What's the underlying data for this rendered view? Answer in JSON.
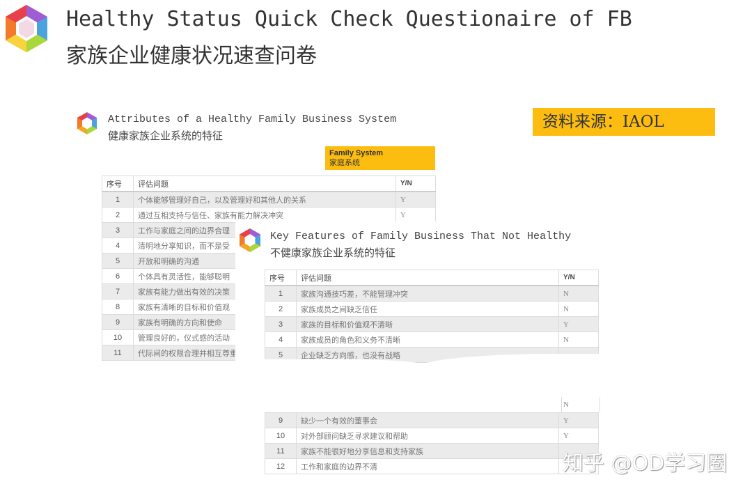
{
  "header": {
    "logo_icon": "hexagon-logo-icon",
    "title_en": "Healthy Status Quick Check Questionaire of FB",
    "title_zh": "家族企业健康状况速查问卷"
  },
  "source": {
    "label": "资料来源：IAOL"
  },
  "healthy_section": {
    "icon": "hexagon-logo-icon",
    "title_en": "Attributes of a Healthy Family Business System",
    "title_zh": "健康家族企业系统的特征",
    "tag_en": "Family System",
    "tag_zh": "家庭系统",
    "columns": [
      "序号",
      "评估问题",
      "Y/N"
    ],
    "rows": [
      {
        "num": "1",
        "question": "个体能够管理好自己，以及管理好和其他人的关系",
        "yn": "Y"
      },
      {
        "num": "2",
        "question": "通过互相支持与信任、家族有能力解决冲突",
        "yn": "Y"
      },
      {
        "num": "3",
        "question": "工作与家庭之间的边界合理",
        "yn": ""
      },
      {
        "num": "4",
        "question": "清明地分享知识，而不是受",
        "yn": ""
      },
      {
        "num": "5",
        "question": "开放和明确的沟通",
        "yn": ""
      },
      {
        "num": "6",
        "question": "个体具有灵活性，能够聪明",
        "yn": ""
      },
      {
        "num": "7",
        "question": "家族有能力做出有效的决策",
        "yn": ""
      },
      {
        "num": "8",
        "question": "家族有清晰的目标和价值观",
        "yn": ""
      },
      {
        "num": "9",
        "question": "家族有明确的方向和使命",
        "yn": ""
      },
      {
        "num": "10",
        "question": "管理良好的，仪式感的活动",
        "yn": ""
      },
      {
        "num": "11",
        "question": "代际间的权限合理并相互尊重",
        "yn": ""
      }
    ]
  },
  "unhealthy_section": {
    "icon": "hexagon-logo-icon",
    "title_en": "Key Features of Family Business That Not Healthy",
    "title_zh": "不健康家族企业系统的特征",
    "columns": [
      "序号",
      "评估问题",
      "Y/N"
    ],
    "rows_top": [
      {
        "num": "1",
        "question": "家族沟通技巧差，不能管理冲突",
        "yn": "N"
      },
      {
        "num": "2",
        "question": "家族成员之间缺乏信任",
        "yn": "N"
      },
      {
        "num": "3",
        "question": "家族的目标和价值观不清晰",
        "yn": "Y"
      },
      {
        "num": "4",
        "question": "家族成员的角色和义务不清晰",
        "yn": "N"
      },
      {
        "num": "5",
        "question": "企业缺乏方向感，也没有战略",
        "yn": ""
      }
    ],
    "partial_yn": "N",
    "rows_bottom": [
      {
        "num": "9",
        "question": "缺少一个有效的董事会",
        "yn": "Y"
      },
      {
        "num": "10",
        "question": "对外部顾问缺乏寻求建议和帮助",
        "yn": "Y"
      },
      {
        "num": "11",
        "question": "家族不能很好地分享信息和支持家族",
        "yn": ""
      },
      {
        "num": "12",
        "question": "工作和家庭的边界不清",
        "yn": ""
      }
    ]
  },
  "watermark": "知乎 @OD学习圈"
}
